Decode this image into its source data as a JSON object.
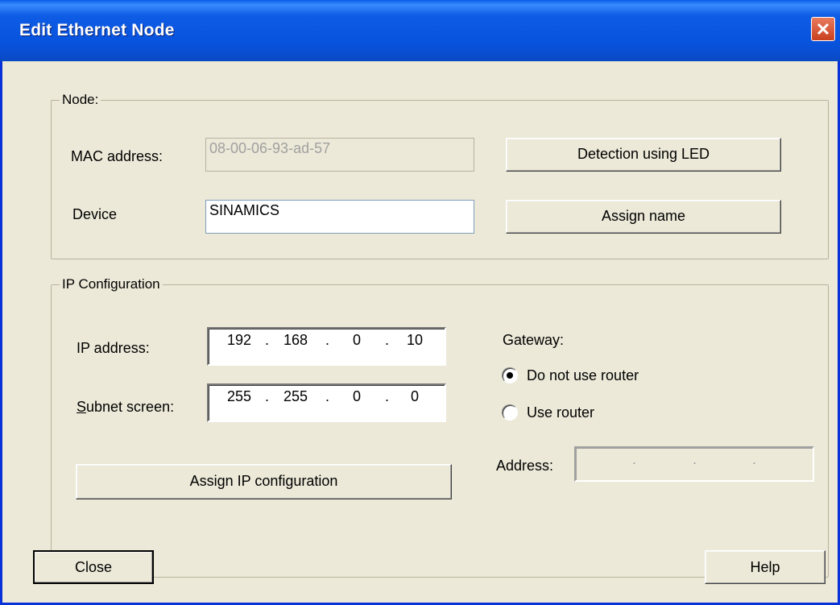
{
  "window": {
    "title": "Edit Ethernet Node"
  },
  "node": {
    "group_label": "Node:",
    "mac_label": "MAC address:",
    "mac_value": "08-00-06-93-ad-57",
    "device_label": "Device",
    "device_value": "SINAMICS",
    "detect_button": "Detection using LED",
    "assign_name_button": "Assign name"
  },
  "ip": {
    "group_label": "IP Configuration",
    "ip_label": "IP address:",
    "ip_octets": [
      "192",
      "168",
      "0",
      "10"
    ],
    "subnet_label_prefix": "S",
    "subnet_label_rest": "ubnet screen:",
    "subnet_octets": [
      "255",
      "255",
      "0",
      "0"
    ],
    "assign_ip_button": "Assign IP configuration",
    "gateway_label": "Gateway:",
    "radio_no_router": "Do not use router",
    "radio_use_router": "Use router",
    "address_label": "Address:",
    "gateway_selected": "no_router"
  },
  "footer": {
    "close_button": "Close",
    "help_button": "Help"
  },
  "colors": {
    "title_bar": "#0853dd",
    "close_button": "#c9401e",
    "dialog_bg": "#ece9d8"
  },
  "icons": {
    "close": "close-icon"
  }
}
